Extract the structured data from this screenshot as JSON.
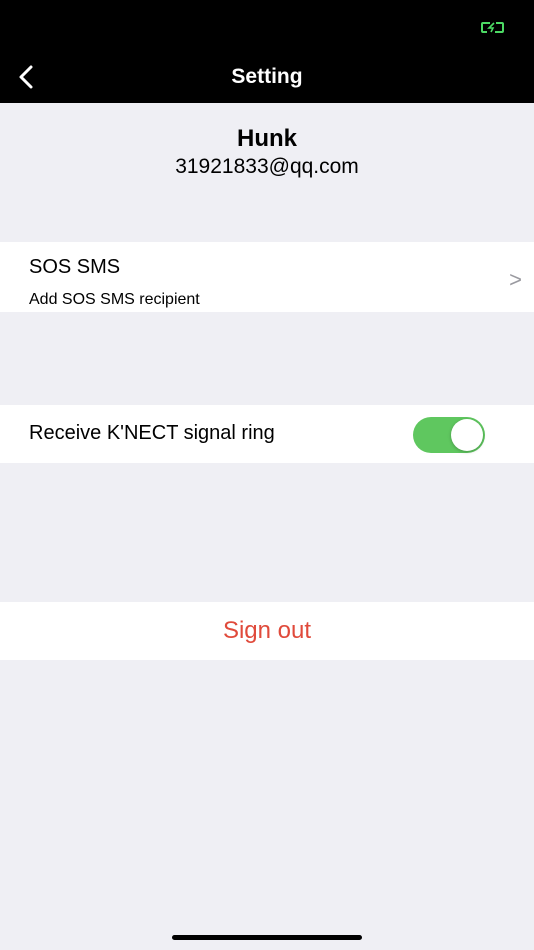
{
  "status_bar": {
    "battery_icon": "battery-charging-icon",
    "battery_color": "#4cd964"
  },
  "header": {
    "title": "Setting",
    "back_icon": "chevron-left-icon"
  },
  "profile": {
    "name": "Hunk",
    "email": "31921833@qq.com"
  },
  "sos": {
    "title": "SOS SMS",
    "subtitle": "Add SOS SMS recipient",
    "chevron": ">"
  },
  "ring": {
    "label": "Receive K'NECT signal ring",
    "enabled": true,
    "toggle_color": "#5fc75f"
  },
  "sign_out": {
    "label": "Sign out",
    "color": "#e04a3b"
  }
}
